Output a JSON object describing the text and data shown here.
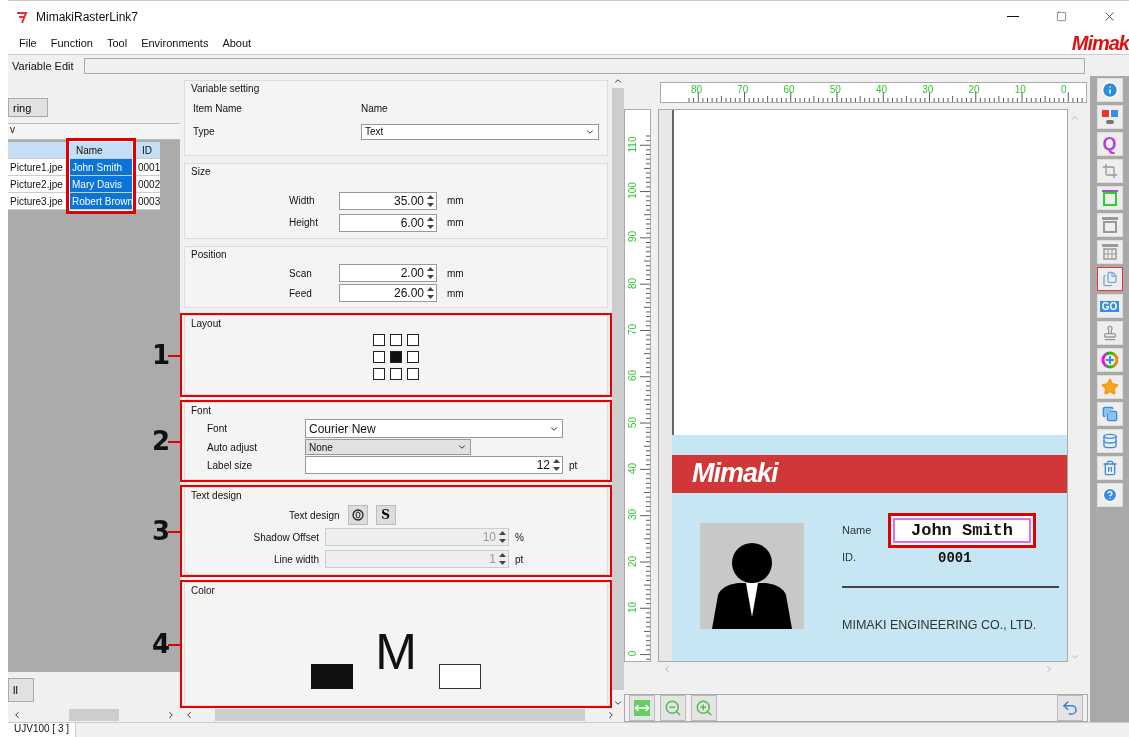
{
  "window": {
    "title": "MimakiRasterLink7",
    "brand": "Mimak"
  },
  "menu": [
    "File",
    "Function",
    "Tool",
    "Environments",
    "About"
  ],
  "tab_label": "Variable Edit",
  "left_panel": {
    "top_button": "ring",
    "subheader": "v",
    "bottom_button": "ll",
    "table": {
      "columns": [
        "",
        "Name",
        "ID"
      ],
      "rows": [
        {
          "file": "Picture1.jpe",
          "name": "John Smith",
          "id": "0001",
          "selected": true
        },
        {
          "file": "Picture2.jpe",
          "name": "Mary Davis",
          "id": "0002",
          "selected": true
        },
        {
          "file": "Picture3.jpe",
          "name": "Robert Brown",
          "id": "0003",
          "selected": true
        }
      ]
    }
  },
  "variable_setting": {
    "title": "Variable setting",
    "item_name_label": "Item Name",
    "item_name_value": "Name",
    "type_label": "Type",
    "type_value": "Text"
  },
  "size": {
    "title": "Size",
    "fields": [
      {
        "label": "Width",
        "value": "35.00",
        "unit": "mm"
      },
      {
        "label": "Height",
        "value": "6.00",
        "unit": "mm"
      }
    ]
  },
  "position": {
    "title": "Position",
    "fields": [
      {
        "label": "Scan",
        "value": "2.00",
        "unit": "mm"
      },
      {
        "label": "Feed",
        "value": "26.00",
        "unit": "mm"
      }
    ]
  },
  "layout": {
    "title": "Layout",
    "callout": "1",
    "cells": [
      {
        "selected": false
      },
      {
        "selected": false
      },
      {
        "selected": false
      },
      {
        "selected": false
      },
      {
        "selected": true
      },
      {
        "selected": false
      },
      {
        "selected": false
      },
      {
        "selected": false
      },
      {
        "selected": false
      }
    ]
  },
  "font": {
    "title": "Font",
    "callout": "2",
    "font_label": "Font",
    "font_value": "Courier New",
    "auto_label": "Auto adjust",
    "auto_value": "None",
    "size_label": "Label size",
    "size_value": "12",
    "size_unit": "pt"
  },
  "text_design": {
    "title": "Text design",
    "callout": "3",
    "label": "Text design",
    "buttons": [
      {
        "kind": "outline"
      },
      {
        "kind": "shadow",
        "label": "S"
      }
    ],
    "fields": [
      {
        "label": "Shadow Offset",
        "value": "10",
        "unit": "%",
        "disabled": true
      },
      {
        "label": "Line width",
        "value": "1",
        "unit": "pt",
        "disabled": true
      }
    ]
  },
  "color": {
    "title": "Color",
    "callout": "4",
    "letter": "M",
    "swatches": [
      {
        "kind": "fill",
        "color": "#111111"
      },
      {
        "kind": "stroke",
        "color": "#ffffff"
      }
    ]
  },
  "preview": {
    "x_ticks": [
      "80",
      "70",
      "60",
      "50",
      "40",
      "30",
      "20",
      "10",
      "0"
    ],
    "y_ticks": [
      "110",
      "100",
      "90",
      "80",
      "70",
      "60",
      "50",
      "40",
      "30",
      "20",
      "10",
      "0"
    ],
    "card": {
      "logo": "Mimaki",
      "name_label": "Name",
      "name_value": "John Smith",
      "id_label": "ID.",
      "id_value": "0001",
      "company": "MIMAKI ENGINEERING CO., LTD."
    }
  },
  "toolbar": [
    {
      "kind": "info",
      "selected": false
    },
    {
      "kind": "toggle",
      "selected": false
    },
    {
      "kind": "letter",
      "label": "Q",
      "selected": false
    },
    {
      "kind": "crop",
      "selected": false
    },
    {
      "kind": "frame",
      "selected": false
    },
    {
      "kind": "frame-gray",
      "selected": false
    },
    {
      "kind": "grid",
      "selected": false
    },
    {
      "kind": "copy-layout",
      "selected": true
    },
    {
      "kind": "go",
      "label": "GO",
      "selected": false
    },
    {
      "kind": "stamp",
      "selected": false
    },
    {
      "kind": "wheel",
      "selected": false
    },
    {
      "kind": "star",
      "selected": false
    },
    {
      "kind": "copy",
      "selected": false
    },
    {
      "kind": "database",
      "selected": false
    },
    {
      "kind": "trash",
      "selected": false
    },
    {
      "kind": "help",
      "selected": false
    }
  ],
  "status_bar": "UJV100 [ 3 ]"
}
